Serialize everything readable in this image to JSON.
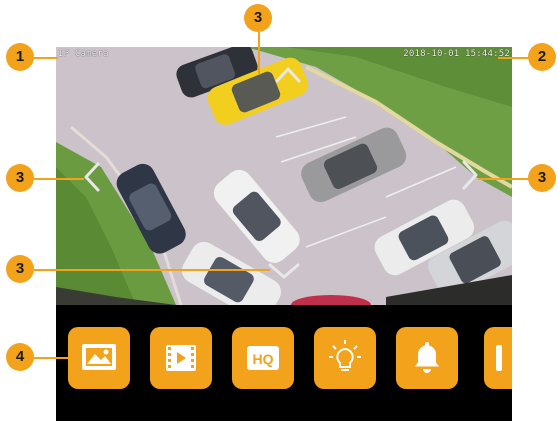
{
  "overlay": {
    "camera_label": "IP Camera",
    "timestamp": "2018-10-01 15:44:52"
  },
  "ptz": {
    "up": "chevron-up-icon",
    "down": "chevron-down-icon",
    "left": "chevron-left-icon",
    "right": "chevron-right-icon"
  },
  "toolbar": {
    "buttons": [
      {
        "id": "snapshot",
        "icon": "image-icon"
      },
      {
        "id": "record",
        "icon": "video-icon"
      },
      {
        "id": "quality",
        "icon": "hq-icon",
        "label": "HQ"
      },
      {
        "id": "light",
        "icon": "lightbulb-icon"
      },
      {
        "id": "alarm",
        "icon": "bell-icon"
      },
      {
        "id": "more",
        "icon": "partial-icon"
      }
    ]
  },
  "callouts": {
    "feed_label": "1",
    "timestamp": "2",
    "ptz_up": "3",
    "ptz_left": "3",
    "ptz_right": "3",
    "ptz_down": "3",
    "toolbar": "4"
  },
  "colors": {
    "accent": "#f2a21b",
    "toolbar_bg": "#000000"
  }
}
